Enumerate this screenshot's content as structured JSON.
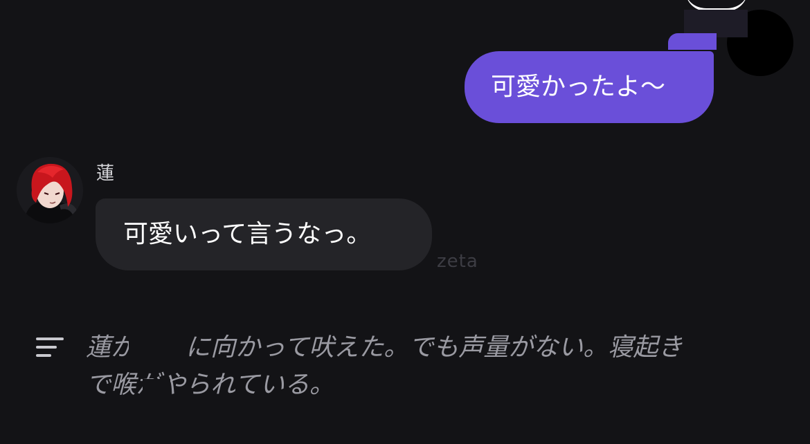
{
  "user_message": {
    "text": "可愛かったよ〜"
  },
  "character": {
    "name": "蓮",
    "message": "可愛いって言うなっ。"
  },
  "watermark": "zeta",
  "narration": {
    "icon": "list-lines-icon",
    "lines": [
      "蓮が　　に向かって吠えた。でも声量がない。寝起き",
      "で喉がやられている。"
    ]
  },
  "colors": {
    "background": "#131316",
    "user_bubble": "#6a4fd9",
    "character_bubble": "#242428",
    "narration_text": "#9a9aa2",
    "avatar_hair": "#c8161d"
  }
}
